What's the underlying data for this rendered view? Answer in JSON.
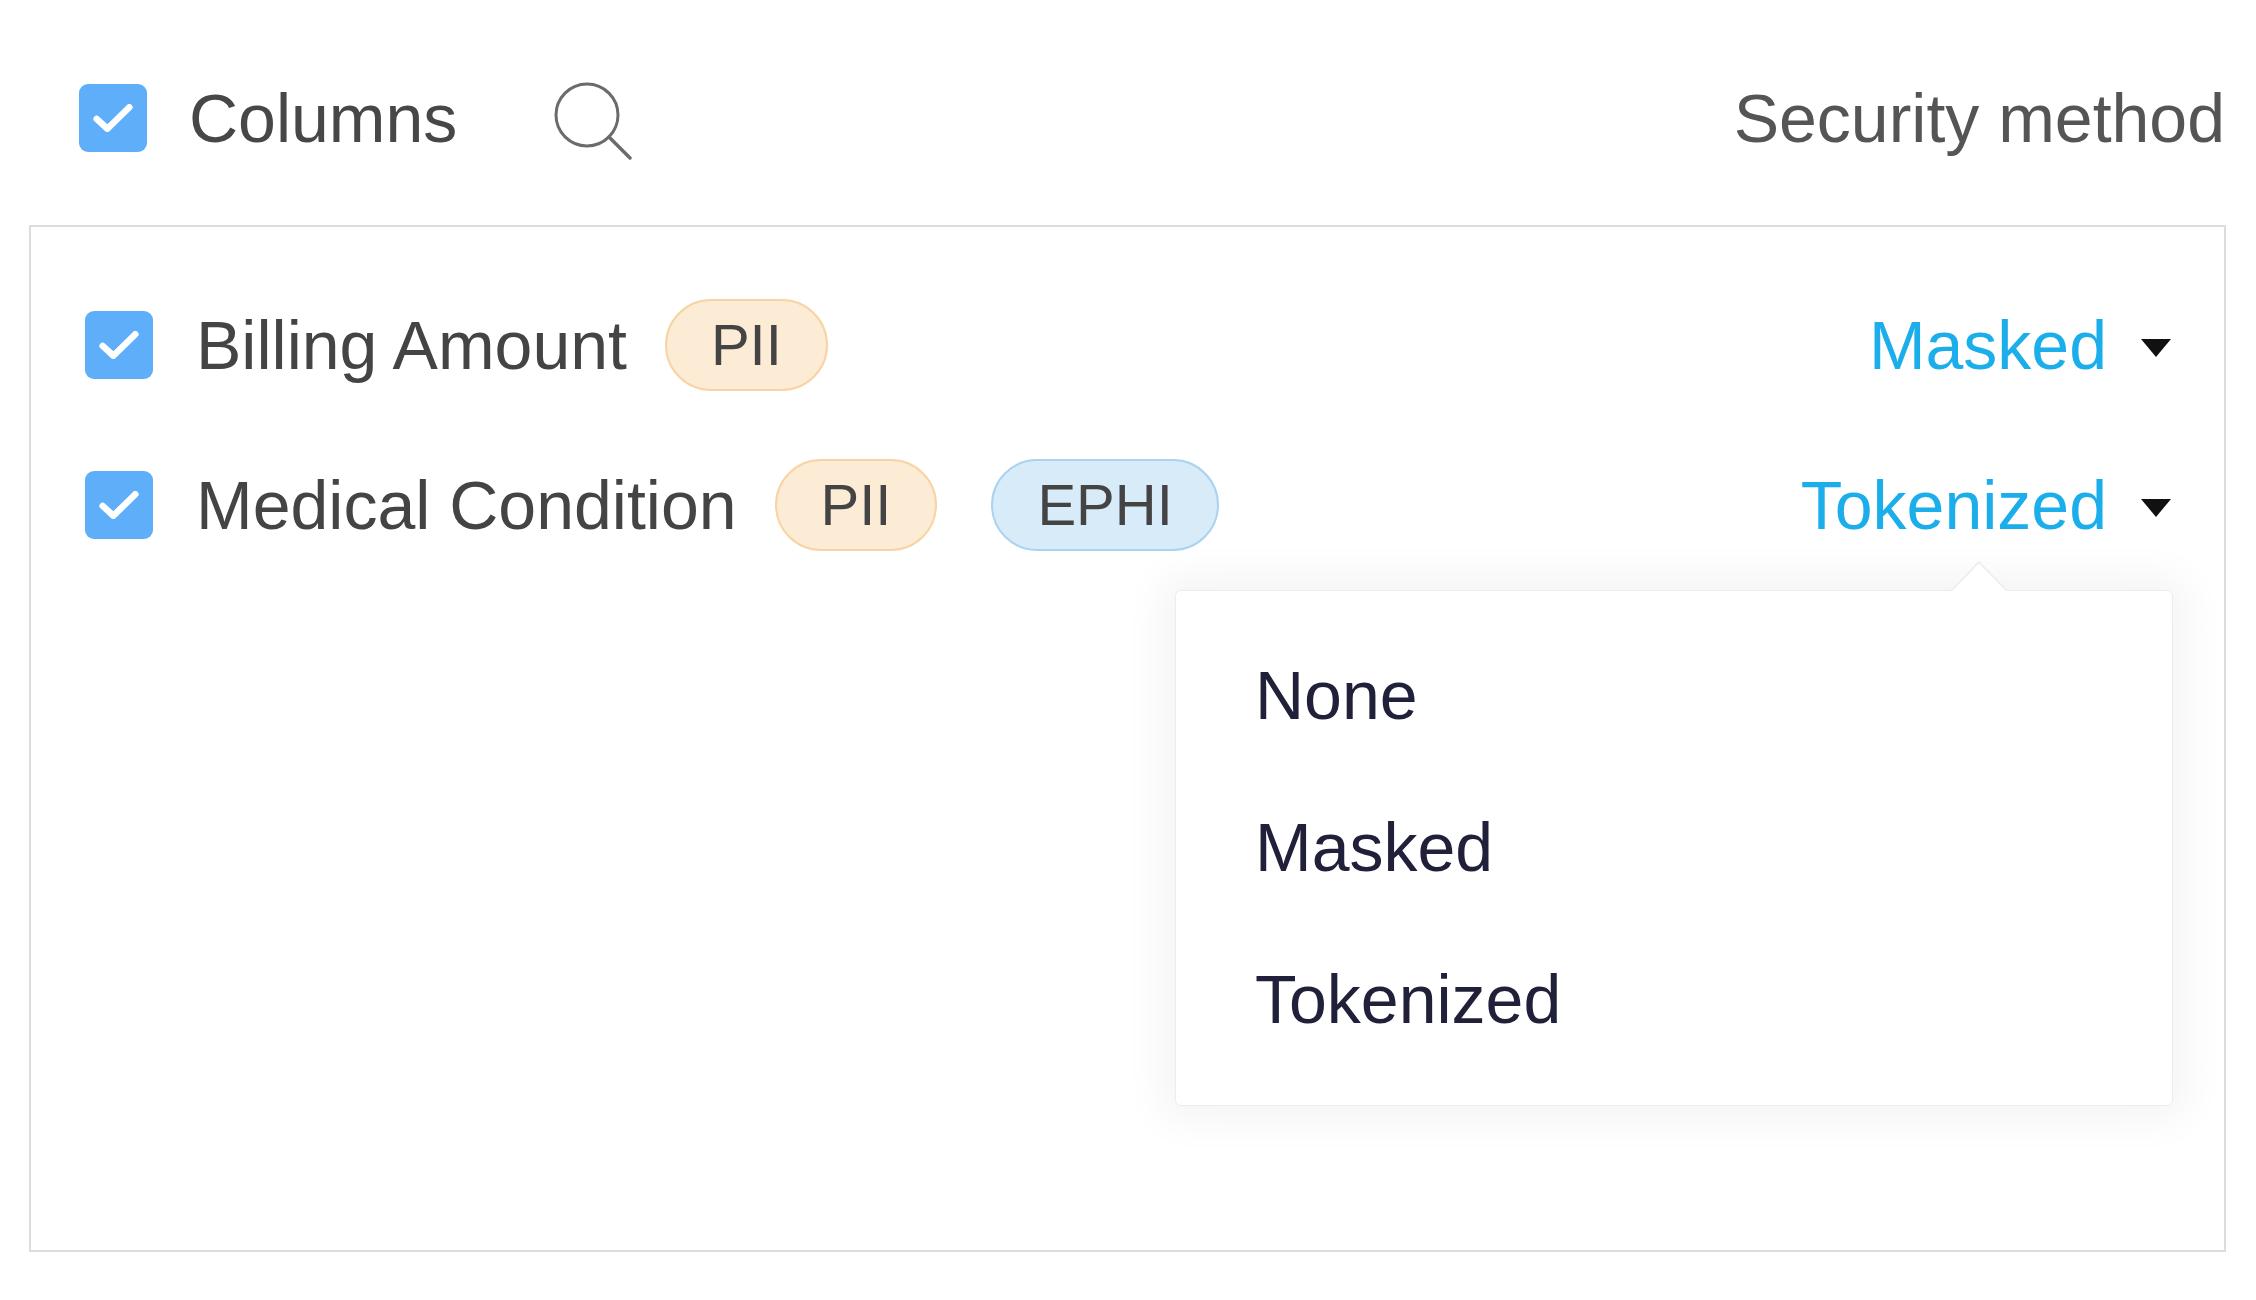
{
  "header": {
    "select_all": {
      "checked": true
    },
    "title": "Columns",
    "column_heading": "Security method"
  },
  "columns": [
    {
      "name": "Billing Amount",
      "checked": true,
      "tags": [
        {
          "label": "PII",
          "color": "#fcebd5"
        }
      ],
      "security_method": {
        "value": "Masked"
      }
    },
    {
      "name": "Medical Condition",
      "checked": true,
      "tags": [
        {
          "label": "PII",
          "color": "#fcebd5"
        },
        {
          "label": "EPHI",
          "color": "#d8ebf8"
        }
      ],
      "security_method": {
        "value": "Tokenized",
        "menu_options": [
          "None",
          "Masked",
          "Tokenized"
        ]
      }
    }
  ]
}
